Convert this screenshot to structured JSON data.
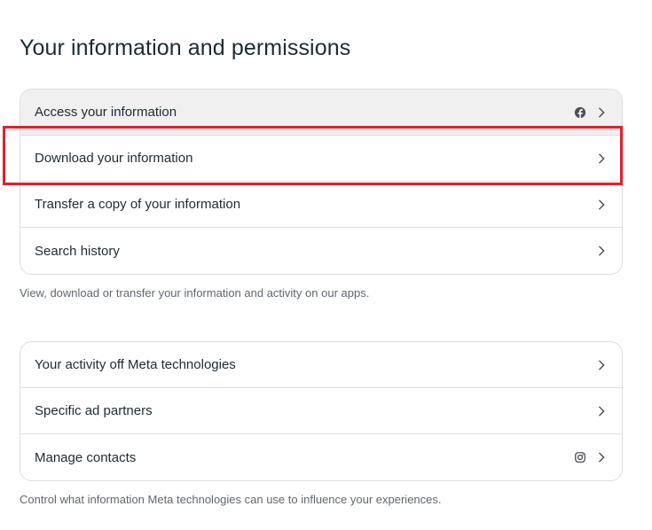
{
  "page": {
    "title": "Your information and permissions"
  },
  "section1": {
    "items": [
      {
        "label": "Access your information",
        "app_icon": "facebook-icon"
      },
      {
        "label": "Download your information"
      },
      {
        "label": "Transfer a copy of your information"
      },
      {
        "label": "Search history"
      }
    ],
    "caption": "View, download or transfer your information and activity on our apps."
  },
  "section2": {
    "items": [
      {
        "label": "Your activity off Meta technologies"
      },
      {
        "label": "Specific ad partners"
      },
      {
        "label": "Manage contacts",
        "app_icon": "instagram-icon"
      }
    ],
    "caption": "Control what information Meta technologies can use to influence your experiences."
  },
  "colors": {
    "highlight_border": "#e0202f",
    "hover_row_bg": "#f0f0f0",
    "card_border": "#dadde1"
  }
}
